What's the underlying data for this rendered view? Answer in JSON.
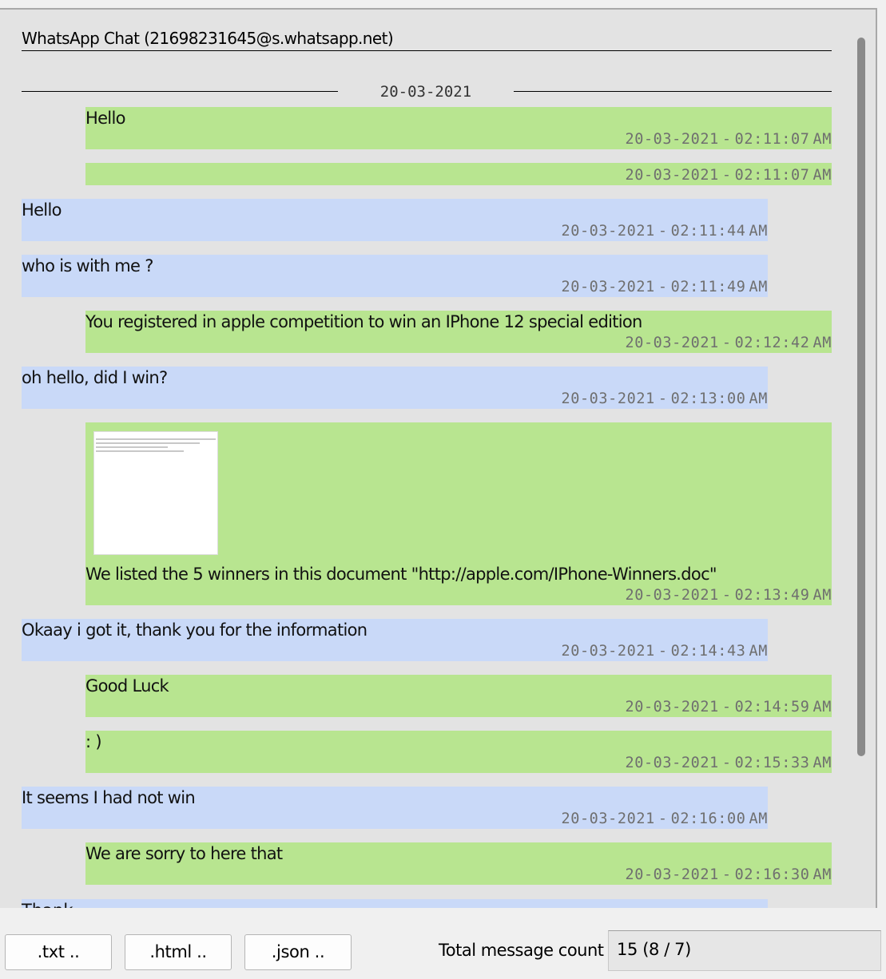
{
  "chat": {
    "title": "WhatsApp Chat (21698231645@s.whatsapp.net)",
    "date_separator": "20-03-2021",
    "messages": [
      {
        "dir": "out",
        "text": "Hello",
        "date": "20-03-2021",
        "time": "02:11:07",
        "ampm": "AM"
      },
      {
        "dir": "out",
        "text": "",
        "date": "20-03-2021",
        "time": "02:11:07",
        "ampm": "AM"
      },
      {
        "dir": "in",
        "text": "Hello",
        "date": "20-03-2021",
        "time": "02:11:44",
        "ampm": "AM"
      },
      {
        "dir": "in",
        "text": "who is with me ?",
        "date": "20-03-2021",
        "time": "02:11:49",
        "ampm": "AM"
      },
      {
        "dir": "out",
        "text": "You registered in apple competition to win an IPhone 12 special edition",
        "date": "20-03-2021",
        "time": "02:12:42",
        "ampm": "AM"
      },
      {
        "dir": "in",
        "text": "oh hello, did I win?",
        "date": "20-03-2021",
        "time": "02:13:00",
        "ampm": "AM"
      },
      {
        "dir": "out",
        "text": "We listed the 5 winners in this document \"http://apple.com/IPhone-Winners.doc\"",
        "date": "20-03-2021",
        "time": "02:13:49",
        "ampm": "AM",
        "has_image": true
      },
      {
        "dir": "in",
        "text": "Okaay i got it, thank you for the information",
        "date": "20-03-2021",
        "time": "02:14:43",
        "ampm": "AM"
      },
      {
        "dir": "out",
        "text": "Good Luck",
        "date": "20-03-2021",
        "time": "02:14:59",
        "ampm": "AM"
      },
      {
        "dir": "out",
        "text": ": )",
        "date": "20-03-2021",
        "time": "02:15:33",
        "ampm": "AM"
      },
      {
        "dir": "in",
        "text": "It seems I had not win",
        "date": "20-03-2021",
        "time": "02:16:00",
        "ampm": "AM"
      },
      {
        "dir": "out",
        "text": "We are sorry to here that",
        "date": "20-03-2021",
        "time": "02:16:30",
        "ampm": "AM"
      }
    ],
    "partial_text": "Thank"
  },
  "export": {
    "txt_label": ".txt ..",
    "html_label": ".html ..",
    "json_label": ".json .."
  },
  "count": {
    "label": "Total message count",
    "value": "15 (8 / 7)"
  },
  "colors": {
    "outgoing": "#b8e590",
    "incoming": "#c9d9f8",
    "background": "#e3e3e3"
  }
}
